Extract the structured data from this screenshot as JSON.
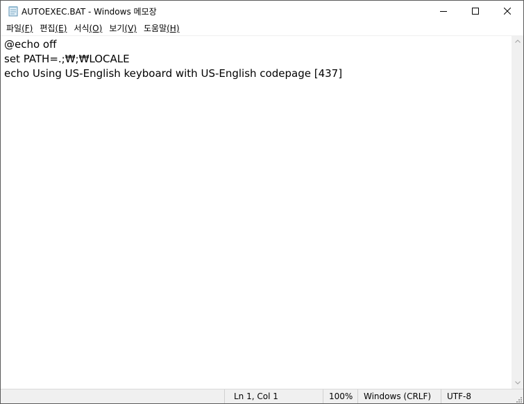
{
  "window": {
    "title": "AUTOEXEC.BAT - Windows 메모장"
  },
  "caption_buttons": {
    "minimize": "minimize-icon",
    "maximize": "maximize-icon",
    "close": "close-icon"
  },
  "menu": {
    "items": [
      {
        "label": "파일",
        "mnemonic": "(F)"
      },
      {
        "label": "편집",
        "mnemonic": "(E)"
      },
      {
        "label": "서식",
        "mnemonic": "(O)"
      },
      {
        "label": "보기",
        "mnemonic": "(V)"
      },
      {
        "label": "도움말",
        "mnemonic": "(H)"
      }
    ]
  },
  "editor": {
    "lines": [
      "@echo off",
      "set PATH=.;₩;₩LOCALE",
      "echo Using US-English keyboard with US-English codepage [437]"
    ]
  },
  "status": {
    "position": "Ln 1, Col 1",
    "zoom": "100%",
    "line_ending": "Windows (CRLF)",
    "encoding": "UTF-8"
  }
}
